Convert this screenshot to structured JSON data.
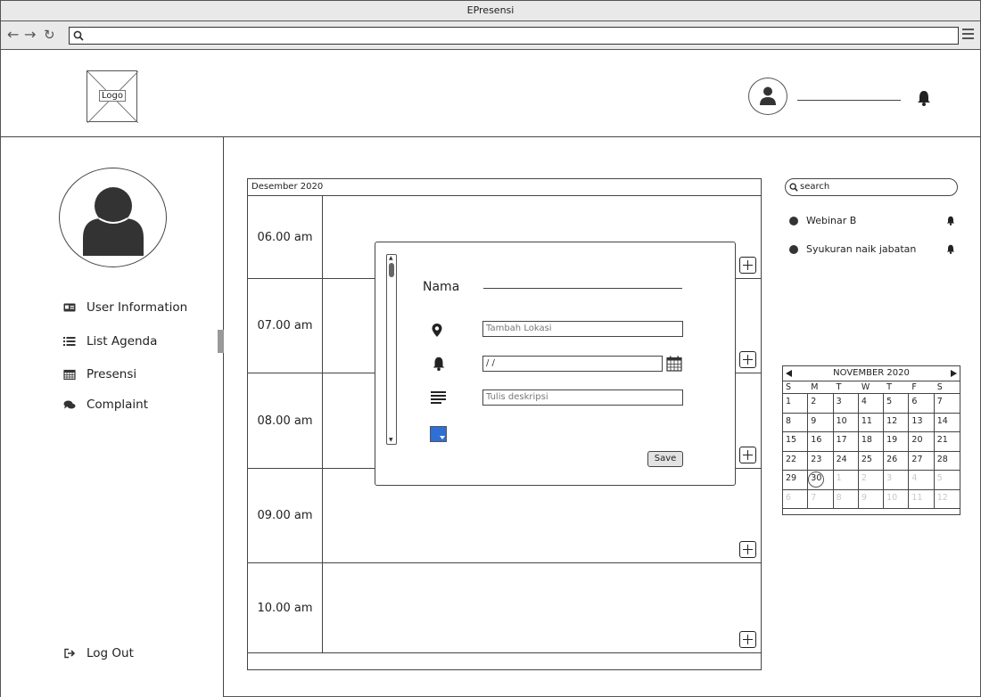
{
  "window": {
    "title": "EPresensi"
  },
  "header": {
    "logo_label": "Logo"
  },
  "sidebar": {
    "items": [
      {
        "label": "User Information",
        "icon": "id-card-icon"
      },
      {
        "label": "List Agenda",
        "icon": "list-icon"
      },
      {
        "label": "Presensi",
        "icon": "calendar-icon"
      },
      {
        "label": "Complaint",
        "icon": "chat-icon"
      }
    ],
    "logout_label": "Log Out"
  },
  "agenda": {
    "month": "Desember 2020",
    "slots": [
      "06.00 am",
      "07.00 am",
      "08.00 am",
      "09.00 am",
      "10.00 am"
    ]
  },
  "dialog": {
    "name_label": "Nama",
    "location_placeholder": "Tambah Lokasi",
    "date_value": " /  /",
    "description_placeholder": "Tulis deskripsi",
    "color_value": "#2f6fd6",
    "save_label": "Save"
  },
  "search": {
    "placeholder": "search"
  },
  "events": [
    "Webinar B",
    "Syukuran naik jabatan"
  ],
  "calendar": {
    "month_label": "NOVEMBER 2020",
    "weekdays": [
      "S",
      "M",
      "T",
      "W",
      "T",
      "F",
      "S"
    ],
    "days": [
      [
        "1",
        "2",
        "3",
        "4",
        "5",
        "6",
        "7"
      ],
      [
        "8",
        "9",
        "10",
        "11",
        "12",
        "13",
        "14"
      ],
      [
        "15",
        "16",
        "17",
        "18",
        "19",
        "20",
        "21"
      ],
      [
        "22",
        "23",
        "24",
        "25",
        "26",
        "27",
        "28"
      ],
      [
        "29",
        "30",
        "1",
        "2",
        "3",
        "4",
        "5"
      ],
      [
        "6",
        "7",
        "8",
        "9",
        "10",
        "11",
        "12"
      ]
    ],
    "today": "30"
  }
}
